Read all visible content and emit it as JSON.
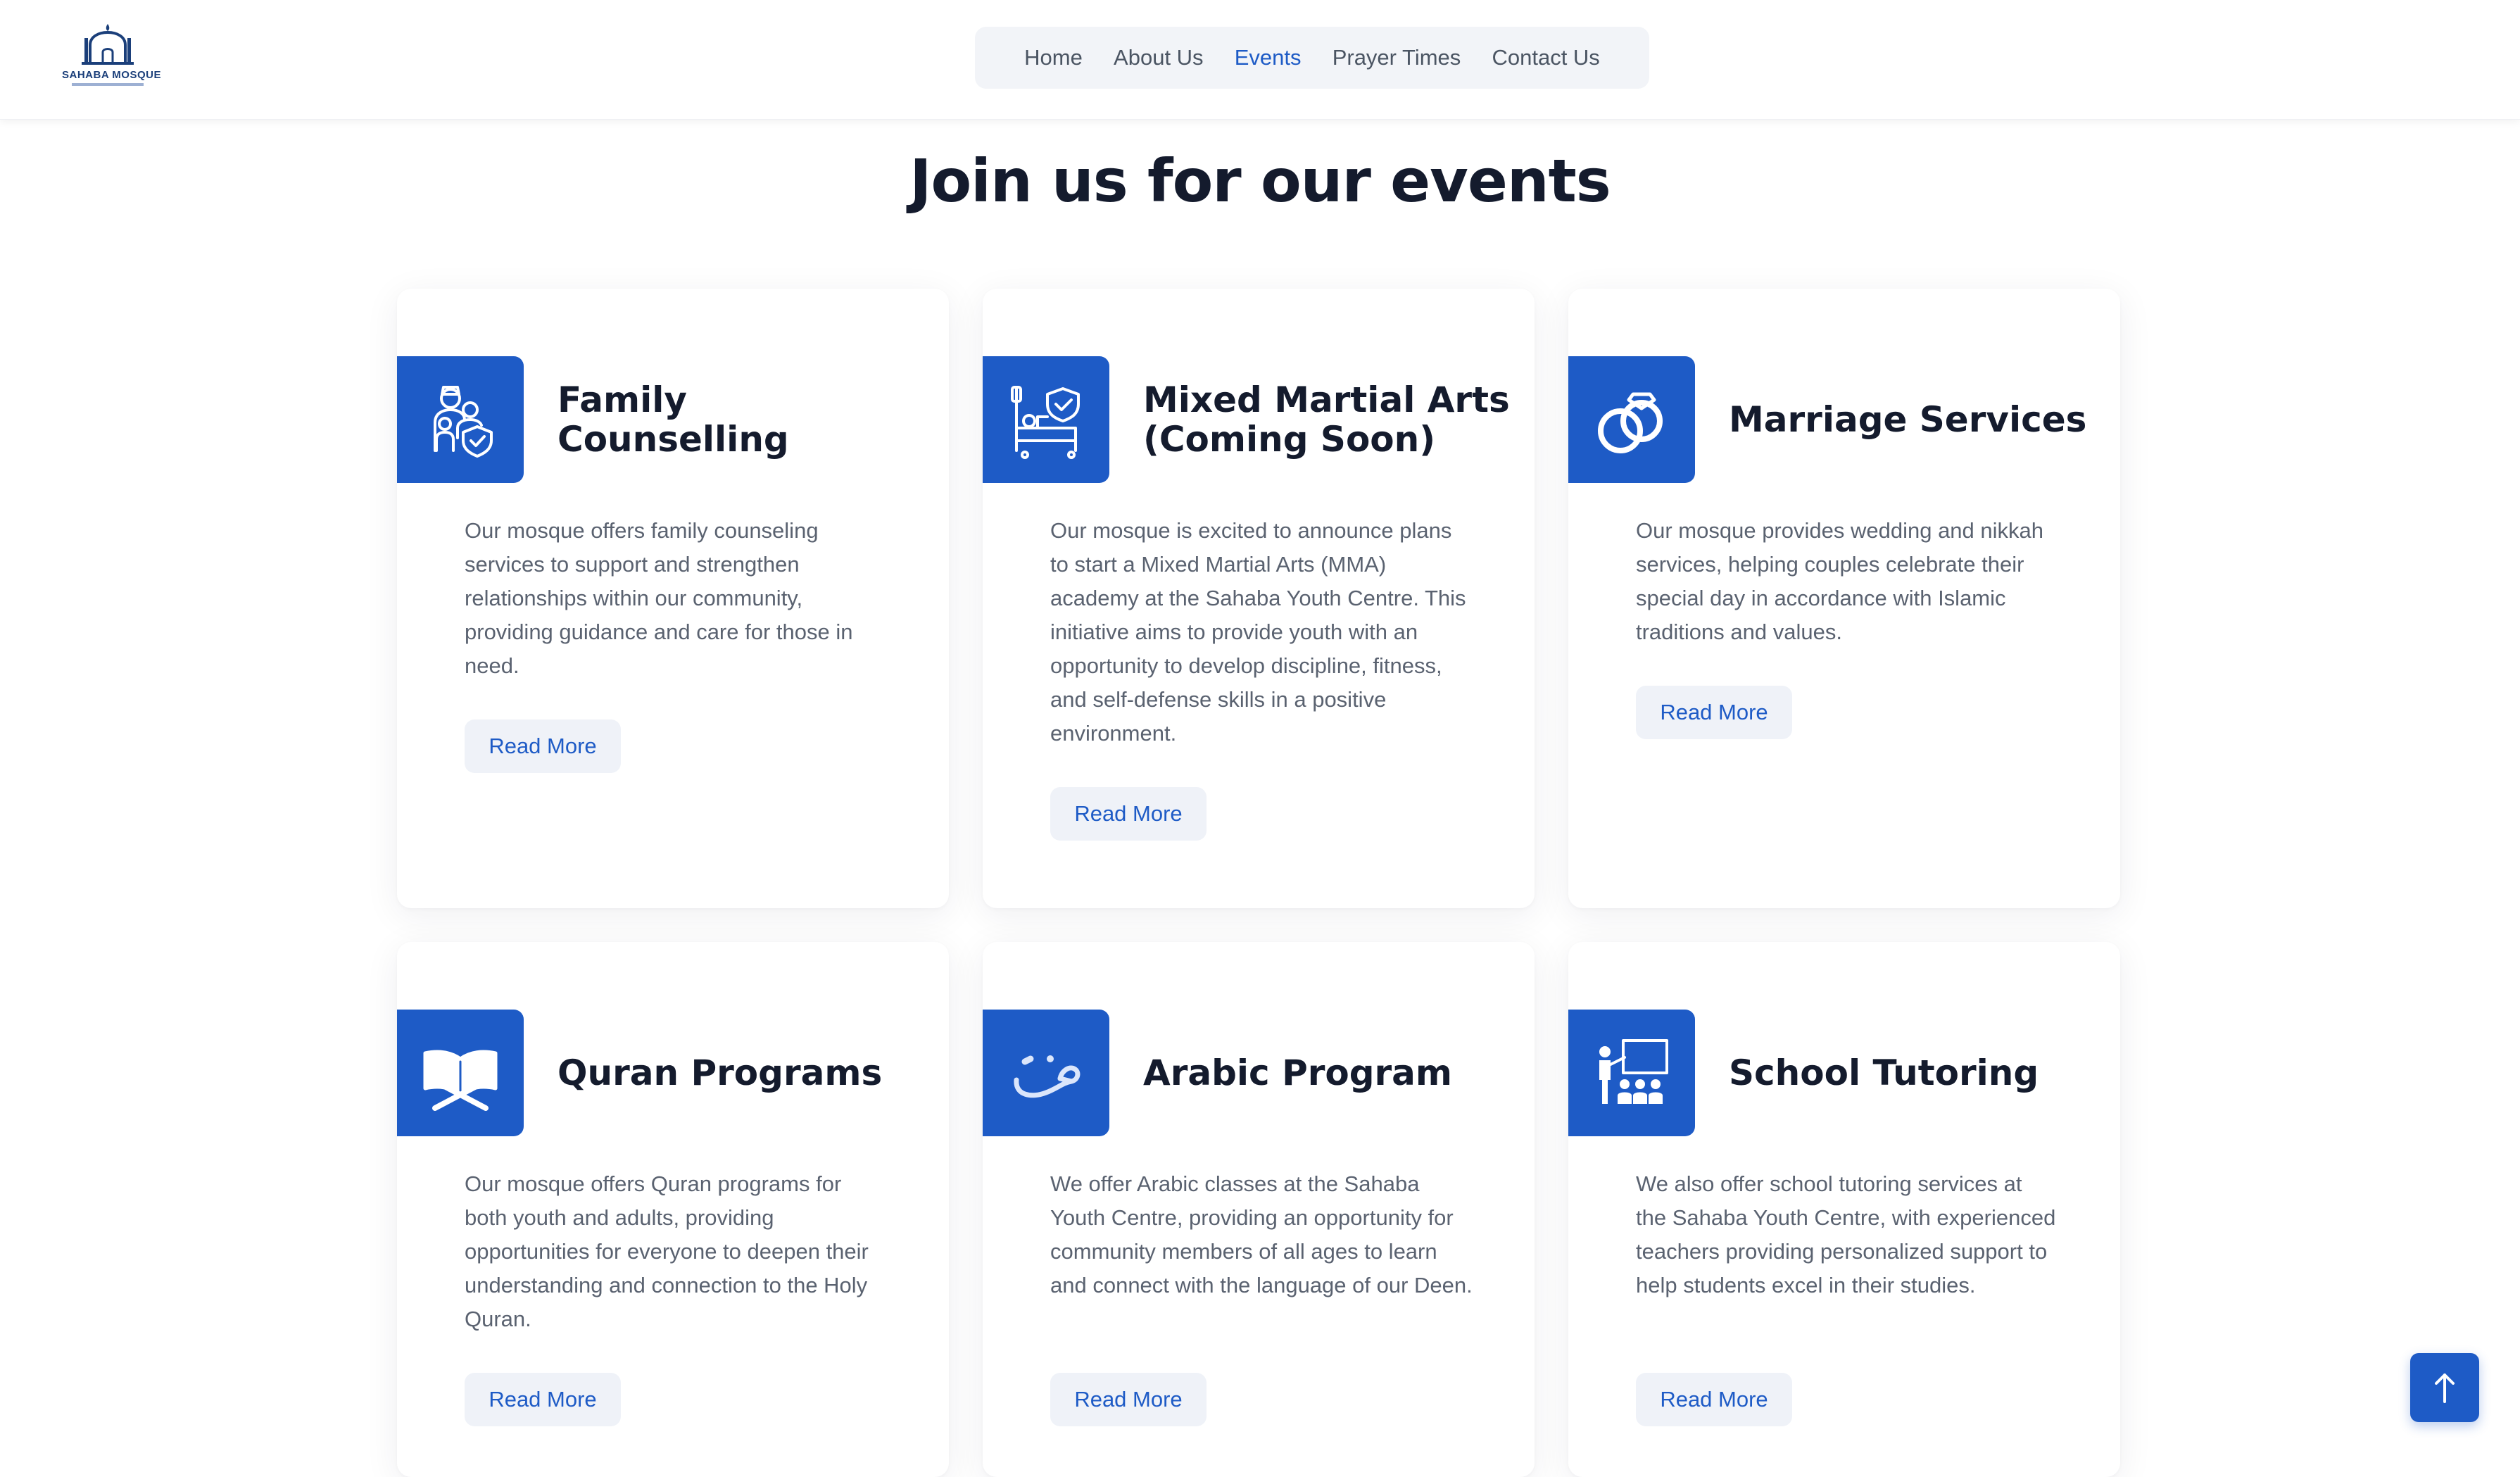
{
  "brand": {
    "logo_text": "SAHABA MOSQUE"
  },
  "nav": {
    "items": [
      {
        "label": "Home"
      },
      {
        "label": "About Us"
      },
      {
        "label": "Events"
      },
      {
        "label": "Prayer Times"
      },
      {
        "label": "Contact Us"
      }
    ],
    "active": "Events"
  },
  "page": {
    "title": "Join us for our events"
  },
  "cards": [
    {
      "title": "Family Counselling",
      "icon": "family-shield-icon",
      "description": "Our mosque offers family counseling services to support and strengthen relationships within our community, providing guidance and care for those in need.",
      "button": "Read More"
    },
    {
      "title": "Mixed Martial Arts (Coming Soon)",
      "icon": "bed-shield-icon",
      "description": "Our mosque is excited to announce plans to start a Mixed Martial Arts (MMA) academy at the Sahaba Youth Centre. This initiative aims to provide youth with an opportunity to develop discipline, fitness, and self-defense skills in a positive environment.",
      "button": "Read More"
    },
    {
      "title": "Marriage Services",
      "icon": "rings-icon",
      "description": "Our mosque provides wedding and nikkah services, helping couples celebrate their special day in accordance with Islamic traditions and values.",
      "button": "Read More"
    },
    {
      "title": "Quran Programs",
      "icon": "quran-book-icon",
      "description": "Our mosque offers Quran programs for both youth and adults, providing opportunities for everyone to deepen their understanding and connection to the Holy Quran.",
      "button": "Read More"
    },
    {
      "title": "Arabic Program",
      "icon": "arabic-letter-icon",
      "description": "We offer Arabic classes at the Sahaba Youth Centre, providing an opportunity for community members of all ages to learn and connect with the language of our Deen.",
      "button": "Read More"
    },
    {
      "title": "School Tutoring",
      "icon": "classroom-icon",
      "description": "We also offer school tutoring services at the Sahaba Youth Centre, with experienced teachers providing personalized support to help students excel in their studies.",
      "button": "Read More"
    }
  ],
  "scroll_top": {
    "icon": "arrow-up-icon"
  },
  "colors": {
    "accent": "#1e5bc6",
    "heading": "#141b2d",
    "body_text": "#5a6270",
    "nav_bg": "#f2f4f8"
  }
}
